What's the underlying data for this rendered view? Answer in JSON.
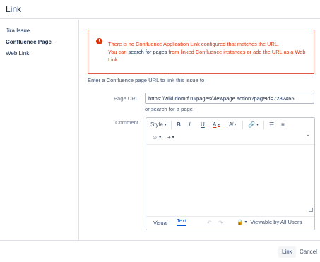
{
  "dialog": {
    "title": "Link"
  },
  "nav": {
    "items": [
      {
        "label": "Jira Issue",
        "active": false
      },
      {
        "label": "Confluence Page",
        "active": true
      },
      {
        "label": "Web Link",
        "active": false
      }
    ]
  },
  "error": {
    "line1": "There is no Confluence Application Link configured that matches the URL.",
    "line2_prefix": "You can ",
    "line2_link1": "search for pages",
    "line2_mid": " from linked Confluence instances or ",
    "line2_link2": "add the URL as a Web Link",
    "line2_suffix": "."
  },
  "hint": "Enter a Confluence page URL to link this issue to",
  "page_url": {
    "label": "Page URL",
    "value": "https://wiki.domrf.ru/pages/viewpage.action?pageId=7282465",
    "search_link": "or search for a page"
  },
  "comment": {
    "label": "Comment",
    "toolbar": {
      "style": "Style",
      "bold": "B",
      "italic": "I",
      "underline": "U",
      "color": "A"
    },
    "tabs": {
      "visual": "Visual",
      "text": "Text"
    },
    "viewable": "Viewable by All Users"
  },
  "buttons": {
    "link": "Link",
    "cancel": "Cancel"
  },
  "colors": {
    "error": "#de350b",
    "accent": "#0052cc"
  }
}
